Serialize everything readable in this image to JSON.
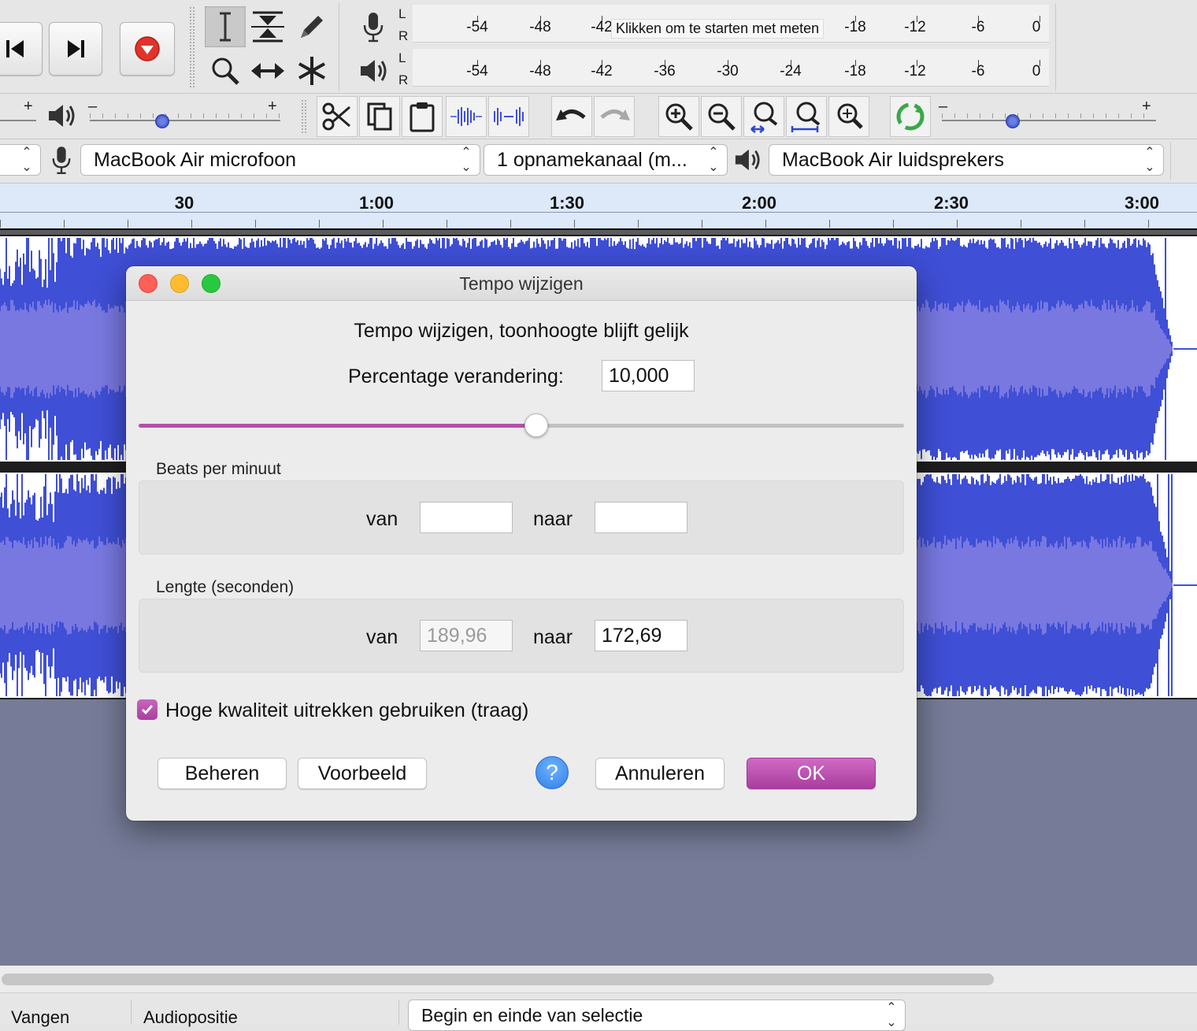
{
  "meters": {
    "record_ticks": [
      "-54",
      "-48",
      "-42",
      "-18",
      "-12",
      "-6",
      "0"
    ],
    "play_ticks": [
      "-54",
      "-48",
      "-42",
      "-36",
      "-30",
      "-24",
      "-18",
      "-12",
      "-6",
      "0"
    ],
    "channel_l": "L",
    "channel_r": "R",
    "start_message": "Klikken om te starten met meten"
  },
  "sliders": {
    "plus": "+",
    "minus": "–"
  },
  "devices": {
    "host": "",
    "input_device": "MacBook Air microfoon",
    "input_channels": "1 opnamekanaal (m...",
    "output_device": "MacBook Air luidsprekers"
  },
  "timeline": {
    "labels": [
      "30",
      "1:00",
      "1:30",
      "2:00",
      "2:30",
      "3:00"
    ]
  },
  "status": {
    "capture_label": "Vangen",
    "audio_position_label": "Audiopositie",
    "selection_mode": "Begin en einde van selectie"
  },
  "dialog": {
    "title": "Tempo wijzigen",
    "heading": "Tempo wijzigen, toonhoogte blijft gelijk",
    "percent_label": "Percentage verandering:",
    "percent_value": "10,000",
    "slider_position": 0.52,
    "bpm_group_label": "Beats per minuut",
    "bpm_from_label": "van",
    "bpm_from_value": "",
    "bpm_to_label": "naar",
    "bpm_to_value": "",
    "length_group_label": "Lengte (seconden)",
    "length_from_label": "van",
    "length_from_value": "189,96",
    "length_to_label": "naar",
    "length_to_value": "172,69",
    "quality_label": "Hoge kwaliteit uitrekken gebruiken (traag)",
    "quality_checked": true,
    "manage_button": "Beheren",
    "preview_button": "Voorbeeld",
    "help_symbol": "?",
    "cancel_button": "Annuleren",
    "ok_button": "OK"
  },
  "colors": {
    "accent": "#b54fab",
    "waveform": "#3f4fd6",
    "waveform_rms": "#7878e0",
    "background_area": "#767c98"
  }
}
